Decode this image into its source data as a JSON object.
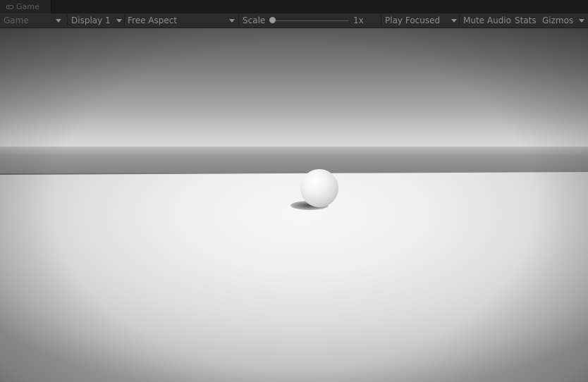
{
  "tab": {
    "label": "Game",
    "icon": "game-controller-icon"
  },
  "toolbar": {
    "view_mode": "Game",
    "display": "Display 1",
    "aspect": "Free Aspect",
    "scale_label": "Scale",
    "scale_value": "1x",
    "scale_fraction": 0.0,
    "play_mode": "Play Focused",
    "mute_audio": "Mute Audio",
    "stats": "Stats",
    "gizmos": "Gizmos"
  },
  "colors": {
    "toolbar_bg": "#2b2b2b",
    "toolbar_text": "#8c8c8c",
    "tab_text": "#5d5d5d"
  }
}
